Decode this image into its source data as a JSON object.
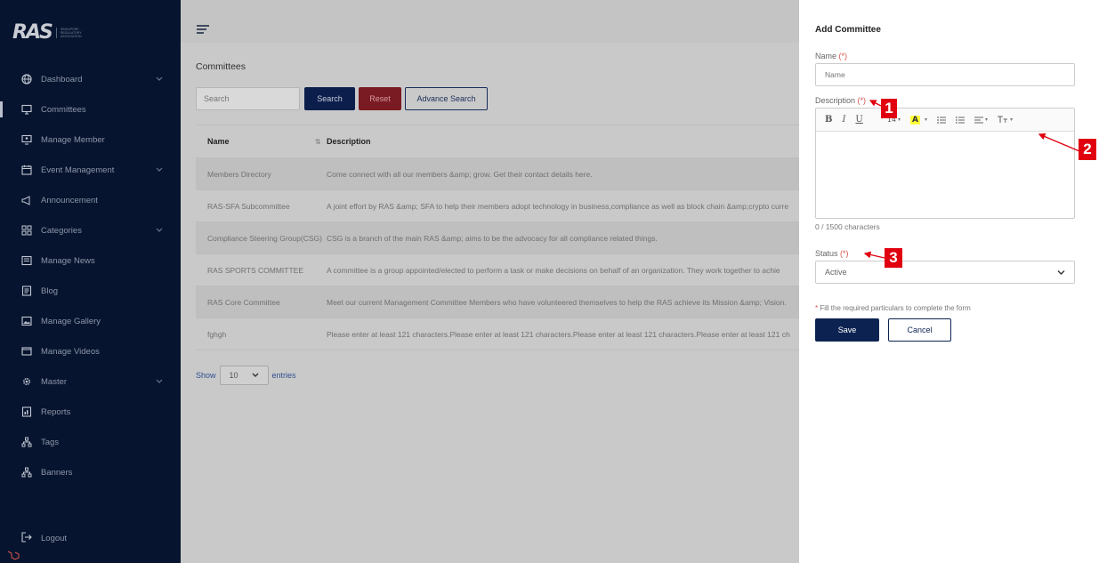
{
  "brand": {
    "logo_text": "RAS",
    "logo_subtext": "SINGAPORE REGULATORY ASSOCIATION"
  },
  "sidebar": {
    "items": [
      {
        "label": "Dashboard",
        "icon": "globe-icon",
        "has_children": true
      },
      {
        "label": "Committees",
        "icon": "monitor-icon",
        "active": true
      },
      {
        "label": "Manage Member",
        "icon": "monitor-users-icon"
      },
      {
        "label": "Event Management",
        "icon": "calendar-icon",
        "has_children": true
      },
      {
        "label": "Announcement",
        "icon": "megaphone-icon"
      },
      {
        "label": "Categories",
        "icon": "grid-icon",
        "has_children": true
      },
      {
        "label": "Manage News",
        "icon": "newspaper-icon"
      },
      {
        "label": "Blog",
        "icon": "blog-icon"
      },
      {
        "label": "Manage Gallery",
        "icon": "image-icon"
      },
      {
        "label": "Manage Videos",
        "icon": "video-icon"
      },
      {
        "label": "Master",
        "icon": "gear-icon",
        "has_children": true
      },
      {
        "label": "Reports",
        "icon": "report-icon"
      },
      {
        "label": "Tags",
        "icon": "sitemap-icon"
      },
      {
        "label": "Banners",
        "icon": "sitemap-icon"
      }
    ],
    "logout_label": "Logout"
  },
  "main": {
    "title": "Committees",
    "search_placeholder": "Search",
    "search_button": "Search",
    "reset_button": "Reset",
    "advance_search_button": "Advance Search",
    "table": {
      "headers": [
        "Name",
        "Description"
      ],
      "rows": [
        {
          "name": "Members Directory",
          "description": "Come connect with all our members &amp; grow. Get their contact details here."
        },
        {
          "name": "RAS-SFA Subcommittee",
          "description": "A joint effort by RAS &amp; SFA to help their members adopt technology in business,compliance as well as block chain &amp;crypto curre"
        },
        {
          "name": "Compliance Steering Group(CSG)",
          "description": "CSG is a branch of the main RAS &amp; aims to be the advocacy for all compliance related things."
        },
        {
          "name": "RAS SPORTS COMMITTEE",
          "description": "A committee is a group appointed/elected to perform a task or make decisions on behalf of an organization. They work together to achie"
        },
        {
          "name": "RAS Core Committee",
          "description": "Meet our current Management Committee Members who have volunteered themselves to help the RAS achieve its Mission &amp; Vision."
        },
        {
          "name": "fghgh",
          "description": "Please enter at least 121 characters.Please enter at least 121 characters.Please enter at least 121 characters.Please enter at least 121 ch"
        }
      ]
    },
    "show_label": "Show",
    "entries_value": "10",
    "entries_label": "entries"
  },
  "form": {
    "title": "Add Committee",
    "name_label": "Name",
    "required_marker": "(*)",
    "name_placeholder": "Name",
    "description_label": "Description",
    "toolbar": {
      "bold": "B",
      "italic": "I",
      "underline": "U",
      "font_size": "14",
      "highlight": "A"
    },
    "char_count": "0 / 1500 characters",
    "status_label": "Status",
    "status_value": "Active",
    "note_marker": "*",
    "note": "Fill the required particulars to complete the form",
    "save_button": "Save",
    "cancel_button": "Cancel"
  },
  "annotations": [
    "1",
    "2",
    "3"
  ],
  "colors": {
    "sidebar_bg": "#06142f",
    "primary": "#0c2352",
    "danger": "#7a1a22",
    "annotation": "#e0000f",
    "required": "#d9534f"
  }
}
